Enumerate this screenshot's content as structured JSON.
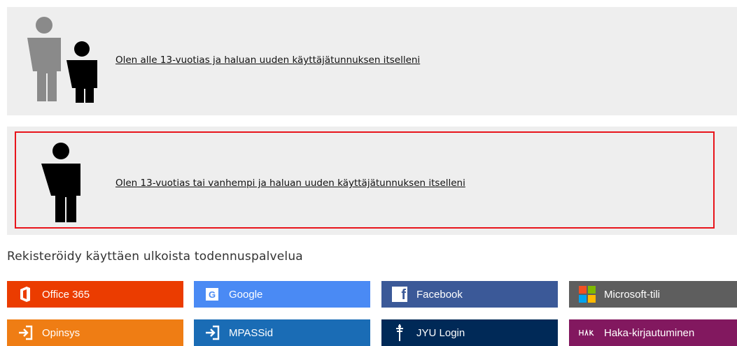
{
  "options": {
    "child": {
      "label": "Olen alle 13-vuotias ja haluan uuden käyttäjätunnuksen itselleni"
    },
    "adult": {
      "label": "Olen 13-vuotias tai vanhempi ja haluan uuden käyttäjätunnuksen itselleni"
    }
  },
  "external": {
    "heading": "Rekisteröidy käyttäen ulkoista todennuspalvelua",
    "providers": [
      {
        "label": "Office 365",
        "icon": "office-icon",
        "color": "#eb3c00"
      },
      {
        "label": "Google",
        "icon": "google-icon",
        "color": "#4a8af4"
      },
      {
        "label": "Facebook",
        "icon": "facebook-icon",
        "color": "#3b5998"
      },
      {
        "label": "Microsoft-tili",
        "icon": "microsoft-icon",
        "color": "#5e5e5e"
      },
      {
        "label": "Opinsys",
        "icon": "login-arrow-icon",
        "color": "#ef7d14"
      },
      {
        "label": "MPASSid",
        "icon": "login-arrow-icon",
        "color": "#1a6cb5"
      },
      {
        "label": "JYU Login",
        "icon": "jyu-icon",
        "color": "#002957"
      },
      {
        "label": "Haka-kirjautuminen",
        "icon": "haka-icon",
        "color": "#82185f"
      }
    ]
  },
  "colors": {
    "panel": "#eeeeee",
    "selection": "#e8141b"
  }
}
